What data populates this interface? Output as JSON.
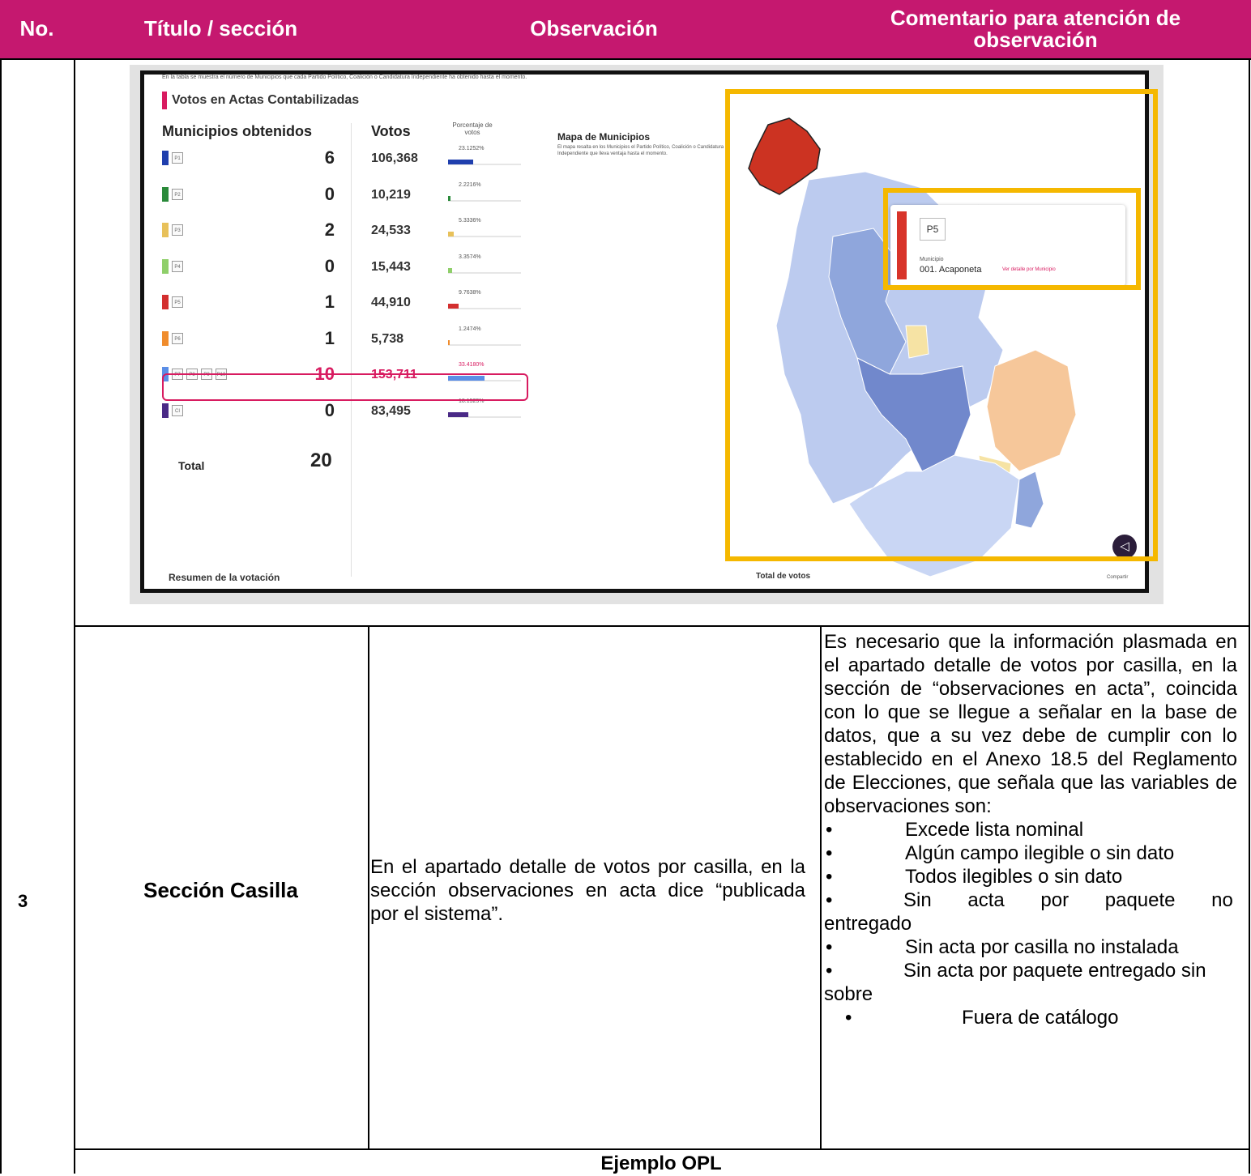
{
  "header": {
    "no": "No.",
    "titulo": "Título / sección",
    "observacion": "Observación",
    "comentario": "Comentario para atención de observación"
  },
  "screenshot": {
    "top_text": "En la tabla se muestra el número de Municipios que cada Partido Político, Coalición o Candidatura Independiente ha obtenido hasta el momento.",
    "section_title": "Votos en Actas Contabilizadas",
    "col_municipios": "Municipios obtenidos",
    "col_votos": "Votos",
    "col_porcentaje": "Porcentaje de votos",
    "rows": [
      {
        "logos": [
          "P1"
        ],
        "municipios": "6",
        "votos": "106,368",
        "pct": "23.1252%",
        "color": "#1f3fae"
      },
      {
        "logos": [
          "P2"
        ],
        "municipios": "0",
        "votos": "10,219",
        "pct": "2.2216%",
        "color": "#2a8a3a"
      },
      {
        "logos": [
          "P3"
        ],
        "municipios": "2",
        "votos": "24,533",
        "pct": "5.3336%",
        "color": "#e8c15a"
      },
      {
        "logos": [
          "P4"
        ],
        "municipios": "0",
        "votos": "15,443",
        "pct": "3.3574%",
        "color": "#8fcf6a"
      },
      {
        "logos": [
          "P5"
        ],
        "municipios": "1",
        "votos": "44,910",
        "pct": "9.7638%",
        "color": "#d32f2f"
      },
      {
        "logos": [
          "P6"
        ],
        "municipios": "1",
        "votos": "5,738",
        "pct": "1.2474%",
        "color": "#f08c2c"
      },
      {
        "logos": [
          "P7",
          "P8",
          "P9",
          "P10"
        ],
        "municipios": "10",
        "votos": "153,711",
        "pct": "33.4180%",
        "color": "#5b8ee6"
      },
      {
        "logos": [
          "CI"
        ],
        "municipios": "0",
        "votos": "83,495",
        "pct": "18.1525%",
        "color": "#4a2a86"
      }
    ],
    "total_label": "Total",
    "total_value": "20",
    "map_title": "Mapa de Municipios",
    "map_desc": "El mapa resalta en los Municipios el Partido Político, Coalición o Candidatura Independiente que lleva ventaja hasta el momento.",
    "popup_party": "P5",
    "popup_label": "Municipio",
    "popup_municipio": "001. Acaponeta",
    "popup_link": "Ver detalle por Municipio",
    "footer_left": "Resumen de la votación",
    "footer_mid": "Total de votos",
    "footer_right": "Compartir"
  },
  "row3": {
    "no": "3",
    "titulo": "Sección Casilla",
    "observacion": "En el apartado detalle de votos por casilla, en la sección observaciones en acta dice “publicada por el sistema”.",
    "comentario_intro": "Es necesario que la información plasmada en el apartado detalle de votos por casilla, en la sección de “observaciones en acta”, coincida con lo que se llegue a señalar en la base de datos, que a su vez debe de cumplir con lo establecido en el Anexo 18.5 del Reglamento de Elecciones, que señala que las variables de observaciones son:",
    "bullets": [
      "Excede lista nominal",
      "Algún campo ilegible o sin dato",
      "Todos ilegibles o sin dato",
      "Sin acta por paquete no entregado",
      "Sin acta por casilla no instalada",
      "Sin acta por paquete entregado sin sobre",
      "Fuera de catálogo"
    ]
  },
  "footer_row": {
    "ejemplo": "Ejemplo OPL"
  },
  "colors": {
    "header_bg": "#c5186f",
    "highlight_frame": "#f5b800",
    "accent_pink": "#d81b60"
  }
}
